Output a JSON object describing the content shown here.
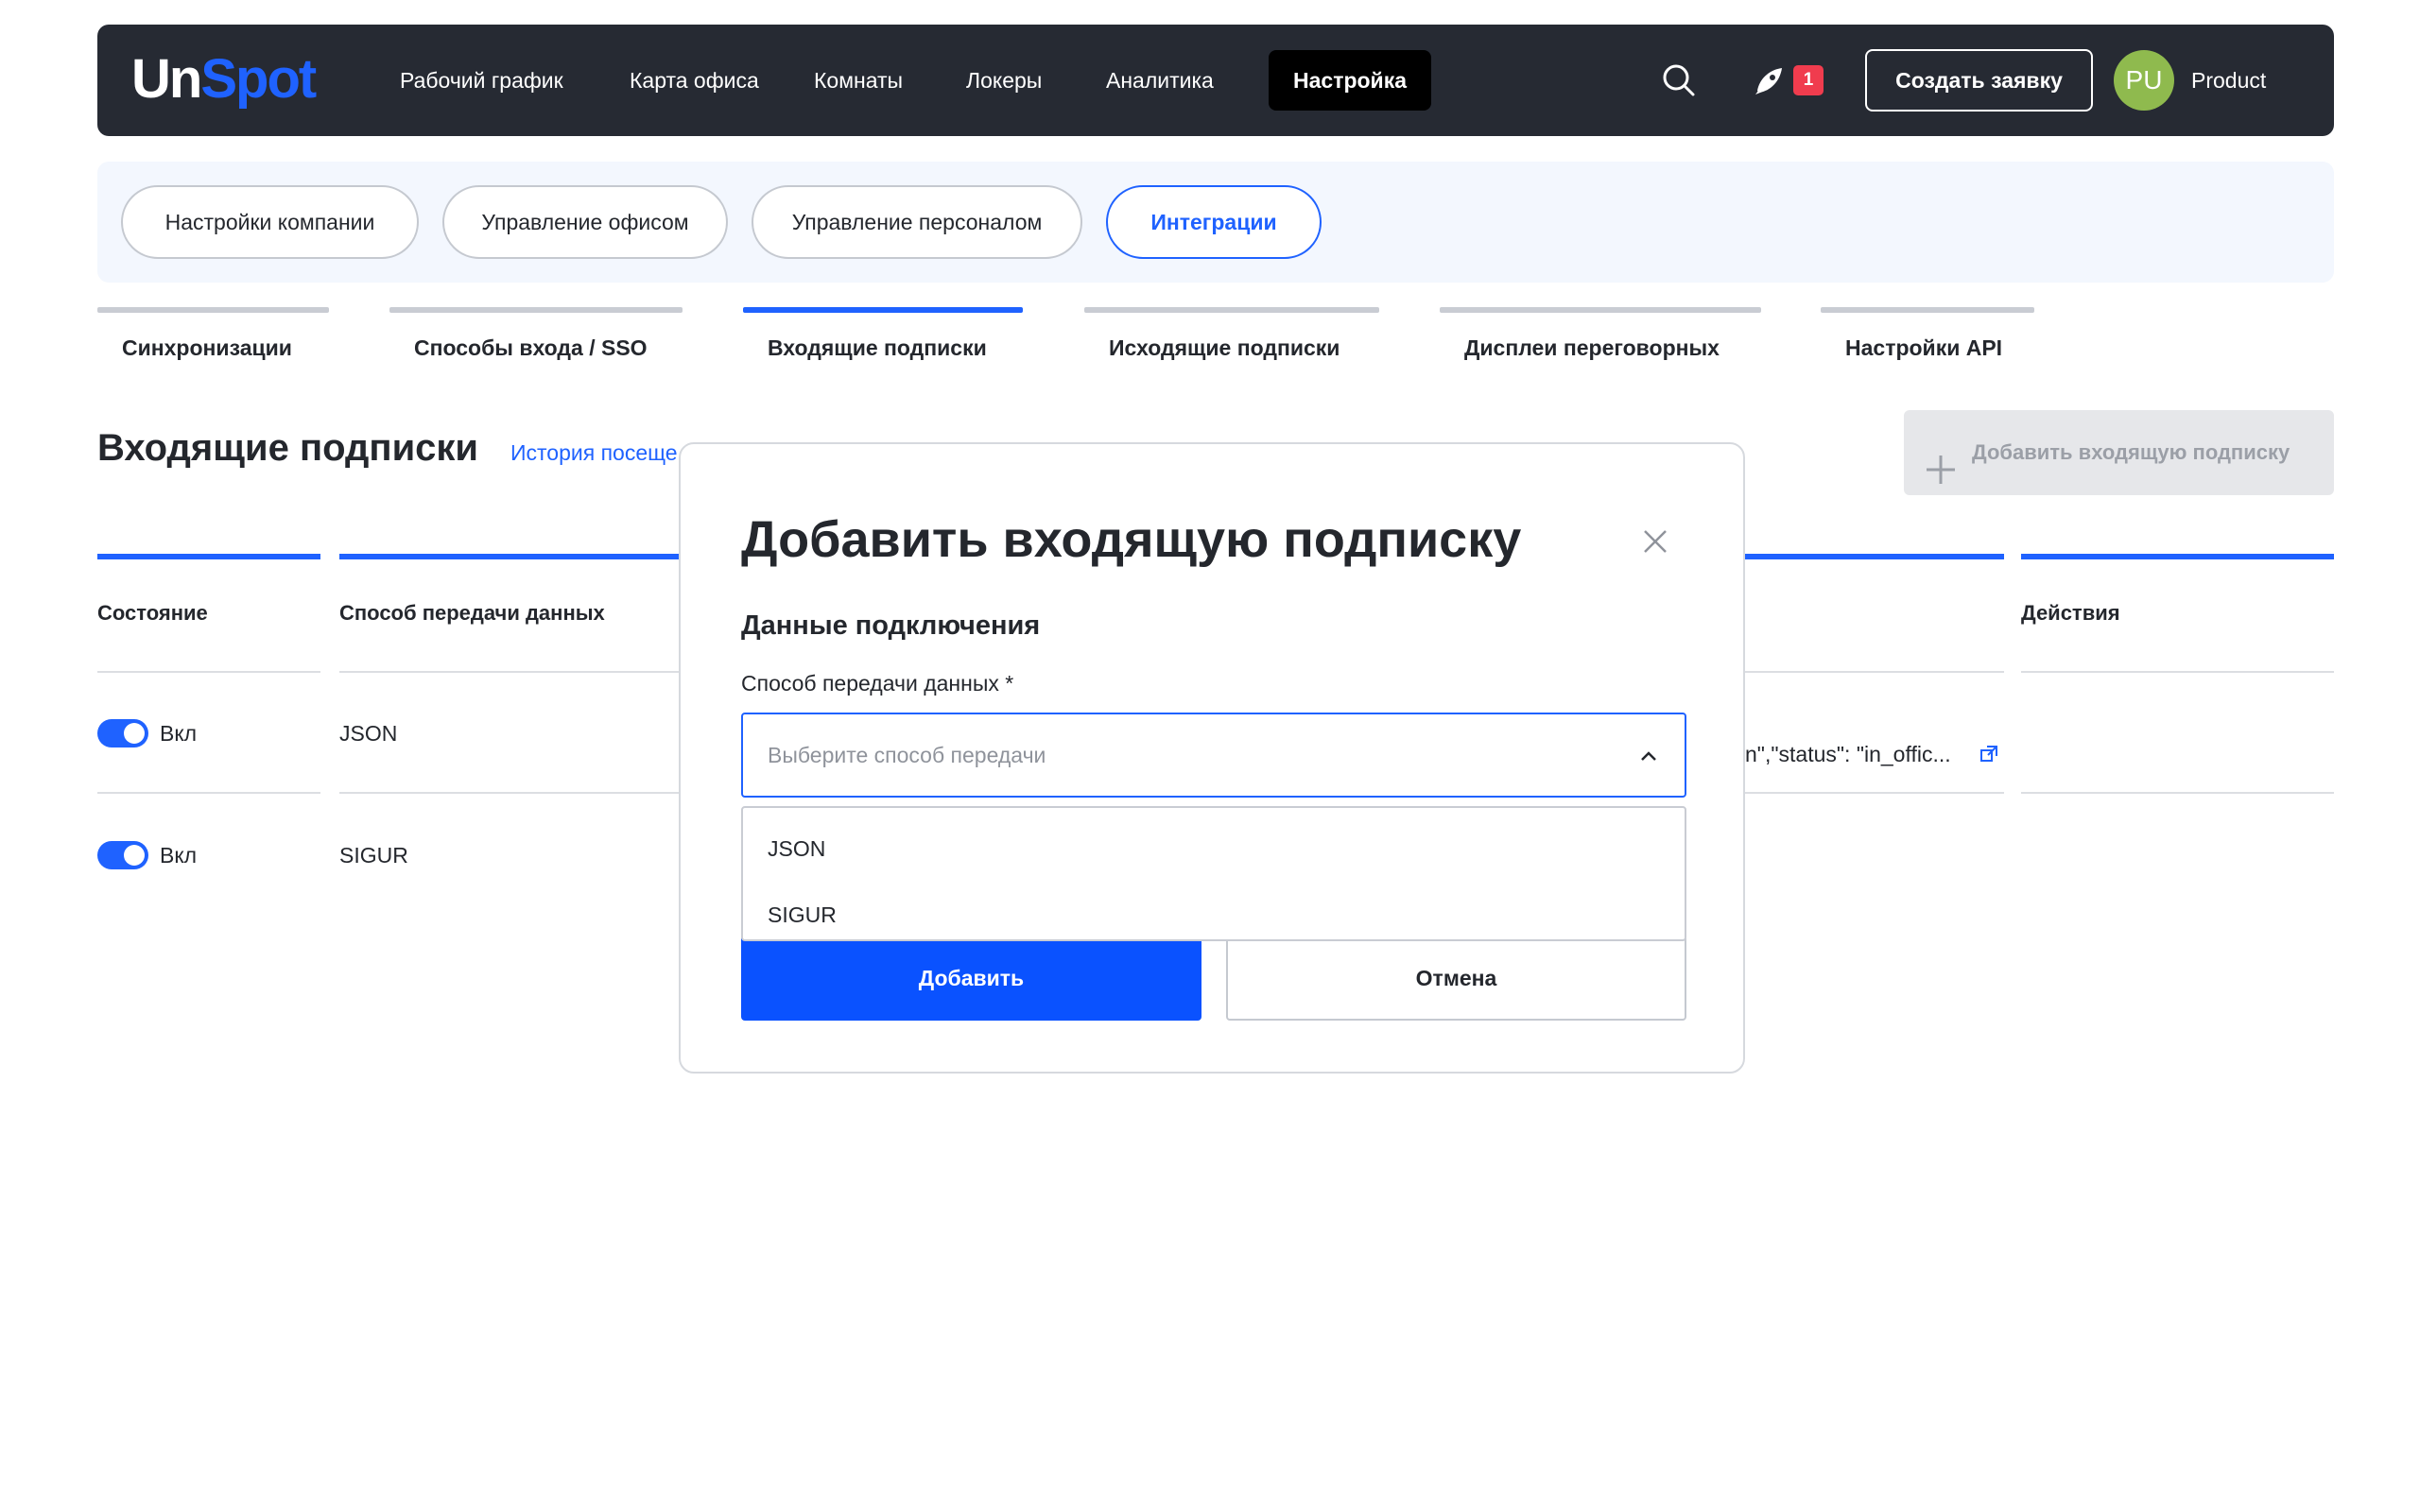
{
  "brand": {
    "part1": "Un",
    "part2": "Spot"
  },
  "nav": {
    "items": [
      "Рабочий график",
      "Карта офиса",
      "Комнаты",
      "Локеры",
      "Аналитика",
      "Настройка"
    ],
    "notification_count": "1",
    "create_button": "Создать заявку",
    "user_initials": "PU",
    "user_name": "Product"
  },
  "sections": [
    "Настройки компании",
    "Управление офисом",
    "Управление персоналом",
    "Интеграции"
  ],
  "subtabs": [
    "Синхронизации",
    "Способы входа / SSO",
    "Входящие подписки",
    "Исходящие подписки",
    "Дисплеи переговорных",
    "Настройки API"
  ],
  "page": {
    "title": "Входящие подписки",
    "history_link": "История посеще",
    "add_button": "Добавить входящую подписку"
  },
  "table": {
    "columns": [
      "Состояние",
      "Способ передачи данных",
      "Действия"
    ],
    "rows": [
      {
        "state": "Вкл",
        "method": "JSON",
        "payload_preview": "n\",\"status\": \"in_offic..."
      },
      {
        "state": "Вкл",
        "method": "SIGUR"
      }
    ]
  },
  "modal": {
    "title": "Добавить входящую подписку",
    "section_title": "Данные подключения",
    "field_label": "Способ передачи данных *",
    "select_placeholder": "Выберите способ передачи",
    "options": [
      "JSON",
      "SIGUR"
    ],
    "submit": "Добавить",
    "cancel": "Отмена"
  },
  "colors": {
    "accent": "#1f62ff",
    "nav_bg": "#262a33",
    "badge": "#f03c4e",
    "avatar": "#8fba4e"
  }
}
